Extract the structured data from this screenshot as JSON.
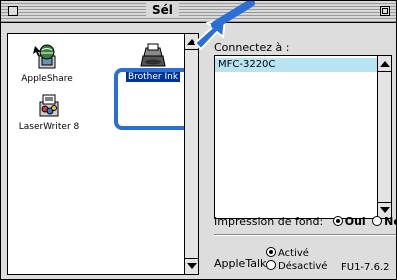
{
  "window": {
    "title": "Sél"
  },
  "chooser": {
    "items": [
      {
        "label": "AppleShare",
        "icon": "appleshare-icon",
        "selected": false
      },
      {
        "label": "Brother Ink",
        "icon": "printer-icon",
        "selected": true
      },
      {
        "label": "LaserWriter 8",
        "icon": "laserwriter-icon",
        "selected": false
      }
    ]
  },
  "connect": {
    "label": "Connectez à :",
    "items": [
      "MFC-3220C"
    ]
  },
  "background_printing": {
    "label": "Impression de fond:",
    "on_label": "Oui",
    "off_label": "Non",
    "value": "Oui"
  },
  "appletalk": {
    "label": "AppleTalk",
    "active_label": "Activé",
    "inactive_label": "Désactivé",
    "value": "Activé"
  },
  "footer": {
    "version": "FU1-7.6.2"
  },
  "colors": {
    "highlight_ring": "#2a6fd6",
    "pointer_arrow": "#2a6fd6",
    "list_selection": "#b7e4f0",
    "label_selection": "#003399"
  }
}
